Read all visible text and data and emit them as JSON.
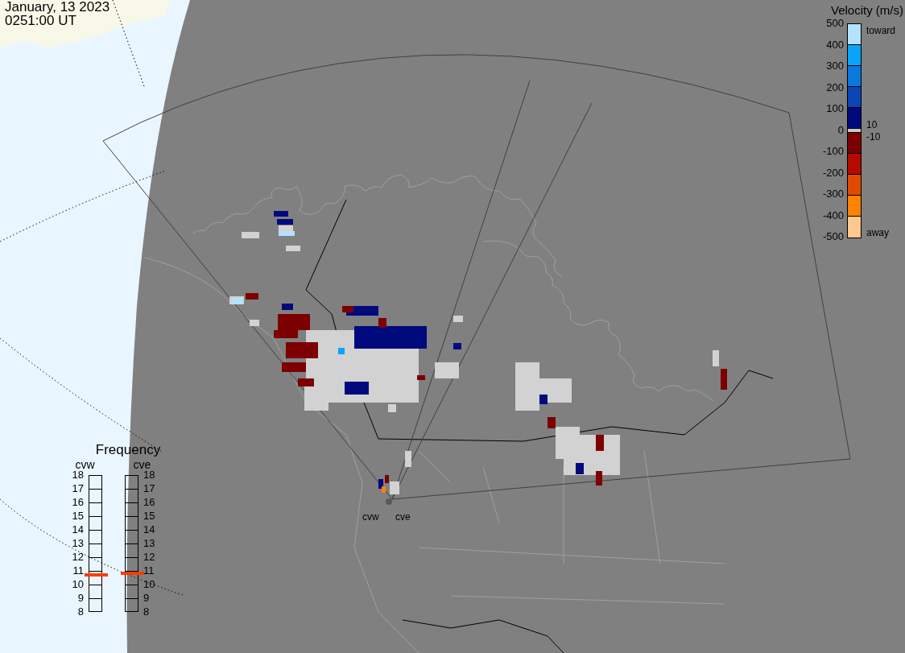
{
  "timestamp": {
    "date": "January, 13 2023",
    "time": "0251:00 UT"
  },
  "velocity_legend": {
    "title": "Velocity (m/s)",
    "ticks": [
      "500",
      "400",
      "300",
      "200",
      "100",
      "0",
      "-100",
      "-200",
      "-300",
      "-400",
      "-500"
    ],
    "segments": [
      {
        "color": "#b4e2ff"
      },
      {
        "color": "#0aa4ff"
      },
      {
        "color": "#0a78dc"
      },
      {
        "color": "#0a46b4"
      },
      {
        "color": "#000a7c"
      },
      {
        "color": "#c8c8c8"
      },
      {
        "color": "#7c0000"
      },
      {
        "color": "#b40a00"
      },
      {
        "color": "#e04a00"
      },
      {
        "color": "#ff8200"
      },
      {
        "color": "#ffc88c"
      }
    ],
    "toward_label": "toward",
    "upper_limit": "10",
    "lower_limit": "-10",
    "away_label": "away"
  },
  "frequency": {
    "title": "Frequency",
    "radars": [
      {
        "name": "cvw",
        "level": 0.27,
        "ticks": [
          "18",
          "17",
          "16",
          "15",
          "14",
          "13",
          "12",
          "11",
          "10",
          "9",
          "8"
        ]
      },
      {
        "name": "cve",
        "level": 0.28,
        "ticks": [
          "18",
          "17",
          "16",
          "15",
          "14",
          "13",
          "12",
          "11",
          "10",
          "9",
          "8"
        ]
      }
    ]
  },
  "radar_labels": [
    "cvw",
    "cve"
  ]
}
